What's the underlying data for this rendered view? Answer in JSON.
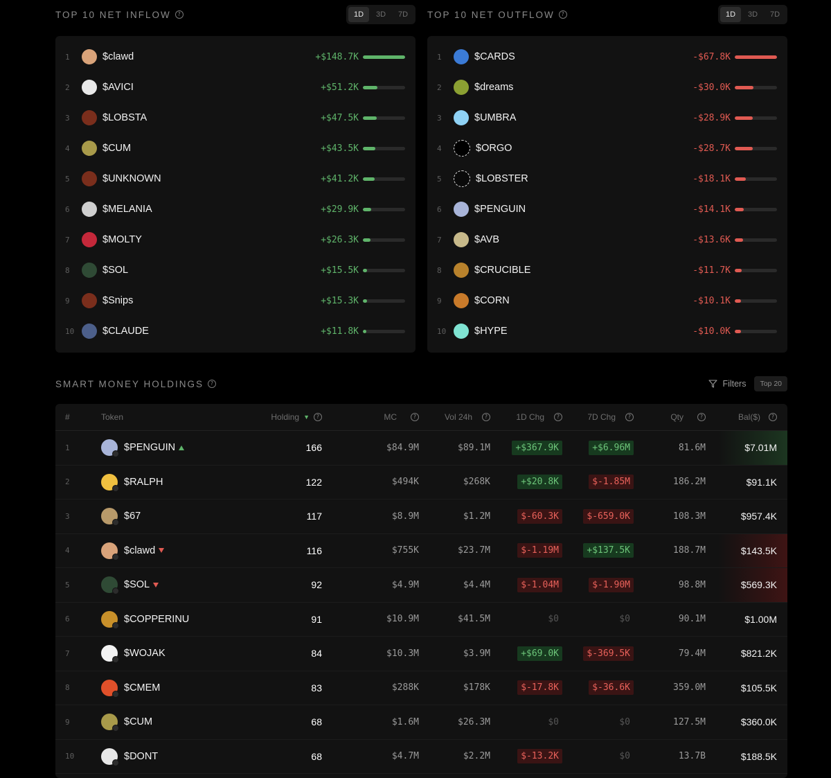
{
  "inflow": {
    "title": "TOP 10 NET INFLOW",
    "timeframes": [
      "1D",
      "3D",
      "7D"
    ],
    "active_timeframe": "1D",
    "accent": "#5fb46a",
    "items": [
      {
        "rank": "1",
        "name": "$clawd",
        "value": "+$148.7K",
        "fraction": 1.0,
        "color": "#d9a37a"
      },
      {
        "rank": "2",
        "name": "$AVICI",
        "value": "+$51.2K",
        "fraction": 0.34,
        "color": "#e8e8e8"
      },
      {
        "rank": "3",
        "name": "$LOBSTA",
        "value": "+$47.5K",
        "fraction": 0.32,
        "color": "#7a2e1c"
      },
      {
        "rank": "4",
        "name": "$CUM",
        "value": "+$43.5K",
        "fraction": 0.29,
        "color": "#a89a4a"
      },
      {
        "rank": "5",
        "name": "$UNKNOWN",
        "value": "+$41.2K",
        "fraction": 0.28,
        "color": "#7a2e1c"
      },
      {
        "rank": "6",
        "name": "$MELANIA",
        "value": "+$29.9K",
        "fraction": 0.2,
        "color": "#cfcfcf"
      },
      {
        "rank": "7",
        "name": "$MOLTY",
        "value": "+$26.3K",
        "fraction": 0.18,
        "color": "#c4283a"
      },
      {
        "rank": "8",
        "name": "$SOL",
        "value": "+$15.5K",
        "fraction": 0.1,
        "color": "#2f4a35"
      },
      {
        "rank": "9",
        "name": "$Snips",
        "value": "+$15.3K",
        "fraction": 0.1,
        "color": "#7a2e1c"
      },
      {
        "rank": "10",
        "name": "$CLAUDE",
        "value": "+$11.8K",
        "fraction": 0.08,
        "color": "#4c5f8a"
      }
    ]
  },
  "outflow": {
    "title": "TOP 10 NET OUTFLOW",
    "timeframes": [
      "1D",
      "3D",
      "7D"
    ],
    "active_timeframe": "1D",
    "accent": "#e05a52",
    "items": [
      {
        "rank": "1",
        "name": "$CARDS",
        "value": "-$67.8K",
        "fraction": 1.0,
        "color": "#3b7bd6"
      },
      {
        "rank": "2",
        "name": "$dreams",
        "value": "-$30.0K",
        "fraction": 0.44,
        "color": "#8ba032"
      },
      {
        "rank": "3",
        "name": "$UMBRA",
        "value": "-$28.9K",
        "fraction": 0.42,
        "color": "#8fd2f5"
      },
      {
        "rank": "4",
        "name": "$ORGO",
        "value": "-$28.7K",
        "fraction": 0.42,
        "color": "#000000"
      },
      {
        "rank": "5",
        "name": "$LOBSTER",
        "value": "-$18.1K",
        "fraction": 0.27,
        "color": "#0a0a0a"
      },
      {
        "rank": "6",
        "name": "$PENGUIN",
        "value": "-$14.1K",
        "fraction": 0.21,
        "color": "#a8b4d8"
      },
      {
        "rank": "7",
        "name": "$AVB",
        "value": "-$13.6K",
        "fraction": 0.2,
        "color": "#c7b98a"
      },
      {
        "rank": "8",
        "name": "$CRUCIBLE",
        "value": "-$11.7K",
        "fraction": 0.17,
        "color": "#b8822c"
      },
      {
        "rank": "9",
        "name": "$CORN",
        "value": "-$10.1K",
        "fraction": 0.15,
        "color": "#c87a2a"
      },
      {
        "rank": "10",
        "name": "$HYPE",
        "value": "-$10.0K",
        "fraction": 0.15,
        "color": "#7fe3d2"
      }
    ]
  },
  "holdings": {
    "title": "SMART MONEY HOLDINGS",
    "filters_label": "Filters",
    "top_badge": "Top 20",
    "columns": {
      "rank": "#",
      "token": "Token",
      "holding": "Holding",
      "mc": "MC",
      "vol": "Vol 24h",
      "d1": "1D Chg",
      "d7": "7D Chg",
      "qty": "Qty",
      "bal": "Bal($)"
    },
    "rows": [
      {
        "rank": "1",
        "name": "$PENGUIN",
        "trend": "up",
        "holding": "166",
        "mc": "$84.9M",
        "vol": "$89.1M",
        "d1": "+$367.9K",
        "d1_sign": "pos",
        "d7": "+$6.96M",
        "d7_sign": "pos",
        "qty": "81.6M",
        "bal": "$7.01M",
        "bal_tint": "pos",
        "color": "#a8b4d8"
      },
      {
        "rank": "2",
        "name": "$RALPH",
        "trend": "none",
        "holding": "122",
        "mc": "$494K",
        "vol": "$268K",
        "d1": "+$20.8K",
        "d1_sign": "pos",
        "d7": "$-1.85M",
        "d7_sign": "neg",
        "qty": "186.2M",
        "bal": "$91.1K",
        "bal_tint": "none",
        "color": "#f0c040"
      },
      {
        "rank": "3",
        "name": "$67",
        "trend": "none",
        "holding": "117",
        "mc": "$8.9M",
        "vol": "$1.2M",
        "d1": "$-60.3K",
        "d1_sign": "neg",
        "d7": "$-659.0K",
        "d7_sign": "neg",
        "qty": "108.3M",
        "bal": "$957.4K",
        "bal_tint": "none",
        "color": "#b89a6a"
      },
      {
        "rank": "4",
        "name": "$clawd",
        "trend": "down",
        "holding": "116",
        "mc": "$755K",
        "vol": "$23.7M",
        "d1": "$-1.19M",
        "d1_sign": "neg",
        "d7": "+$137.5K",
        "d7_sign": "pos",
        "qty": "188.7M",
        "bal": "$143.5K",
        "bal_tint": "neg",
        "color": "#d9a37a"
      },
      {
        "rank": "5",
        "name": "$SOL",
        "trend": "down",
        "holding": "92",
        "mc": "$4.9M",
        "vol": "$4.4M",
        "d1": "$-1.04M",
        "d1_sign": "neg",
        "d7": "$-1.90M",
        "d7_sign": "neg",
        "qty": "98.8M",
        "bal": "$569.3K",
        "bal_tint": "neg",
        "color": "#2f4a35"
      },
      {
        "rank": "6",
        "name": "$COPPERINU",
        "trend": "none",
        "holding": "91",
        "mc": "$10.9M",
        "vol": "$41.5M",
        "d1": "$0",
        "d1_sign": "zero",
        "d7": "$0",
        "d7_sign": "zero",
        "qty": "90.1M",
        "bal": "$1.00M",
        "bal_tint": "none",
        "color": "#c8902a"
      },
      {
        "rank": "7",
        "name": "$WOJAK",
        "trend": "none",
        "holding": "84",
        "mc": "$10.3M",
        "vol": "$3.9M",
        "d1": "+$69.0K",
        "d1_sign": "pos",
        "d7": "$-369.5K",
        "d7_sign": "neg",
        "qty": "79.4M",
        "bal": "$821.2K",
        "bal_tint": "none",
        "color": "#f2f2f2"
      },
      {
        "rank": "8",
        "name": "$CMEM",
        "trend": "none",
        "holding": "83",
        "mc": "$288K",
        "vol": "$178K",
        "d1": "$-17.8K",
        "d1_sign": "neg",
        "d7": "$-36.6K",
        "d7_sign": "neg",
        "qty": "359.0M",
        "bal": "$105.5K",
        "bal_tint": "none",
        "color": "#e0502a"
      },
      {
        "rank": "9",
        "name": "$CUM",
        "trend": "none",
        "holding": "68",
        "mc": "$1.6M",
        "vol": "$26.3M",
        "d1": "$0",
        "d1_sign": "zero",
        "d7": "$0",
        "d7_sign": "zero",
        "qty": "127.5M",
        "bal": "$360.0K",
        "bal_tint": "none",
        "color": "#a89a4a"
      },
      {
        "rank": "10",
        "name": "$DONT",
        "trend": "none",
        "holding": "68",
        "mc": "$4.7M",
        "vol": "$2.2M",
        "d1": "$-13.2K",
        "d1_sign": "neg",
        "d7": "$0",
        "d7_sign": "zero",
        "qty": "13.7B",
        "bal": "$188.5K",
        "bal_tint": "none",
        "color": "#e8e8e8"
      }
    ]
  }
}
